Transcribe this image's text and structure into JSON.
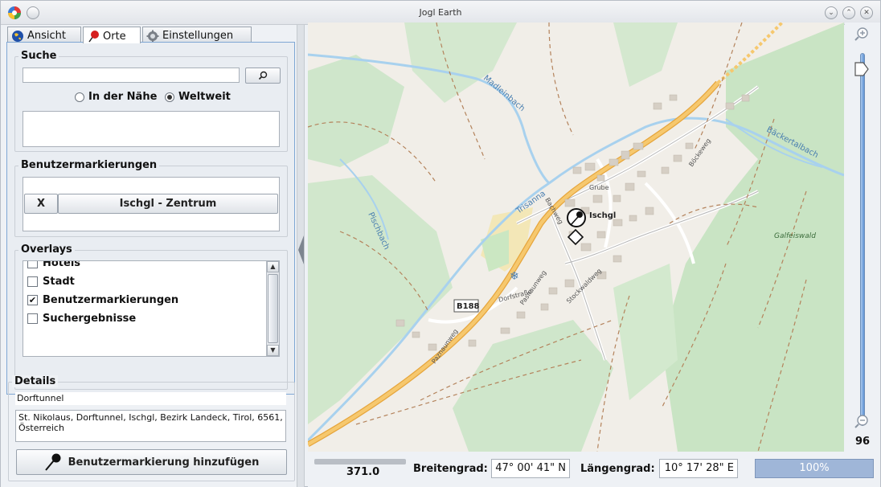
{
  "window": {
    "title": "Jogl Earth"
  },
  "tabs": [
    {
      "label": "Ansicht",
      "icon": "globe-icon"
    },
    {
      "label": "Orte",
      "icon": "pin-icon"
    },
    {
      "label": "Einstellungen",
      "icon": "gear-icon"
    }
  ],
  "search": {
    "legend": "Suche",
    "value": "",
    "radio_near": "In der Nähe",
    "radio_world": "Weltweit",
    "selected": "Weltweit"
  },
  "user_marks": {
    "legend": "Benutzermarkierungen",
    "remove_label": "X",
    "entry_label": "Ischgl - Zentrum"
  },
  "overlays": {
    "legend": "Overlays",
    "items": [
      {
        "label": "Hotels",
        "checked": false
      },
      {
        "label": "Stadt",
        "checked": false
      },
      {
        "label": "Benutzermarkierungen",
        "checked": true
      },
      {
        "label": "Suchergebnisse",
        "checked": false
      }
    ]
  },
  "details": {
    "legend": "Details",
    "name": "Dorftunnel",
    "address": "St. Nikolaus, Dorftunnel, Ischgl, Bezirk Landeck, Tirol, 6561, Österreich",
    "add_button": "Benutzermarkierung hinzufügen"
  },
  "map": {
    "labels": {
      "madleinbach": "Madleinbach",
      "baeckertalbach": "Bäckertalbach",
      "pischbach": "Pischbach",
      "trisanna": "Trisanna",
      "ischgl": "Ischgl",
      "galfeiswald": "Galfeiswald",
      "b188": "B188",
      "grube": "Grube",
      "bachweg": "Bachweg",
      "boeckeweg": "Böckeweg",
      "dorfstrasse": "Dorfstraße",
      "paznaunweg": "Paznaunweg",
      "pasnaunweg": "Pasnaunweg",
      "stockwaldweg": "Stockwaldweg"
    }
  },
  "zoom": {
    "value": "96",
    "level": 0.96
  },
  "status": {
    "scale_value": "371.0",
    "lat_label": "Breitengrad:",
    "lat_value": "47° 00' 41\" N",
    "lon_label": "Längengrad:",
    "lon_value": "10° 17' 28\" E",
    "progress_text": "100%"
  },
  "colors": {
    "accent": "#5f93d4",
    "forest": "#c9e4c4",
    "road_major": "#f4c46a",
    "water": "#a8d1ee"
  }
}
